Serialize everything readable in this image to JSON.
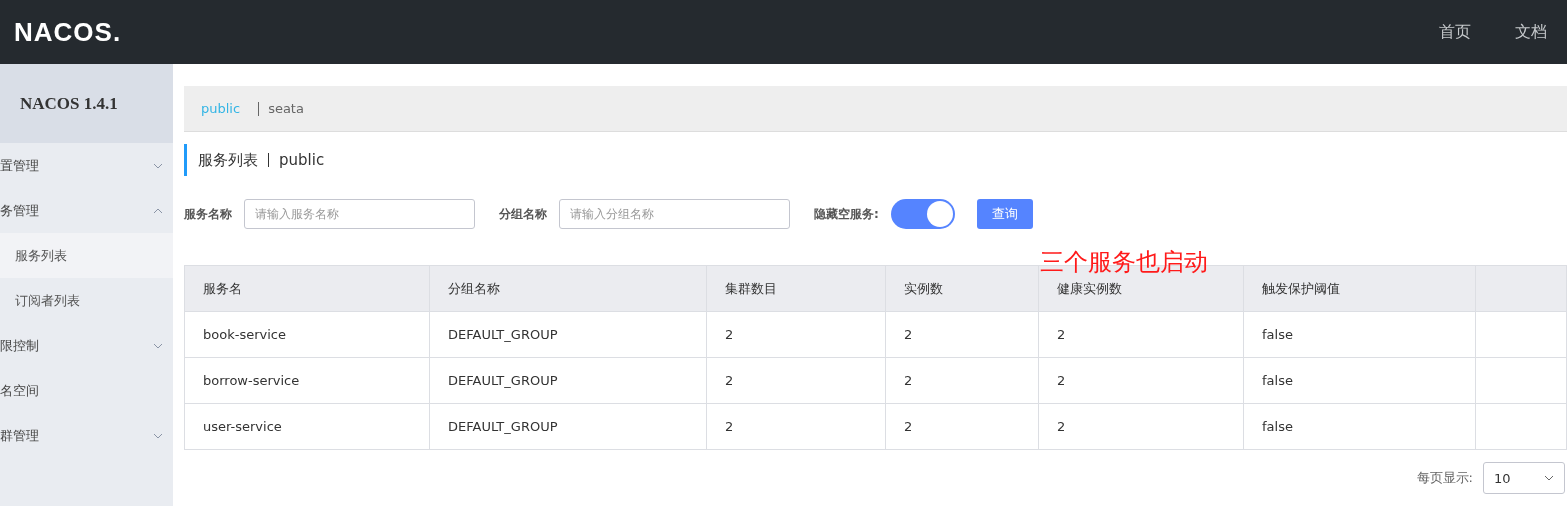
{
  "header": {
    "logo": "NACOS.",
    "nav": [
      "首页",
      "文档"
    ]
  },
  "sidebar": {
    "title": "NACOS 1.4.1",
    "items": [
      {
        "label": "置管理",
        "expanded": false
      },
      {
        "label": "务管理",
        "expanded": true,
        "children": [
          {
            "label": "服务列表",
            "selected": true
          },
          {
            "label": "订阅者列表",
            "selected": false
          }
        ]
      },
      {
        "label": "限控制",
        "expanded": false
      },
      {
        "label": "名空间"
      },
      {
        "label": "群管理",
        "expanded": false
      }
    ]
  },
  "namespaces": [
    {
      "label": "public",
      "selected": true
    },
    {
      "label": "seata",
      "selected": false
    }
  ],
  "page_title": {
    "title": "服务列表",
    "namespace": "public"
  },
  "filters": {
    "service_label": "服务名称",
    "service_placeholder": "请输入服务名称",
    "group_label": "分组名称",
    "group_placeholder": "请输入分组名称",
    "hide_label": "隐藏空服务:",
    "hide_on": true,
    "query_button": "查询"
  },
  "annotation": "三个服务也启动",
  "table": {
    "columns": [
      "服务名",
      "分组名称",
      "集群数目",
      "实例数",
      "健康实例数",
      "触发保护阈值"
    ],
    "rows": [
      [
        "book-service",
        "DEFAULT_GROUP",
        "2",
        "2",
        "2",
        "false"
      ],
      [
        "borrow-service",
        "DEFAULT_GROUP",
        "2",
        "2",
        "2",
        "false"
      ],
      [
        "user-service",
        "DEFAULT_GROUP",
        "2",
        "2",
        "2",
        "false"
      ]
    ]
  },
  "pagination": {
    "label": "每页显示:",
    "page_size": "10"
  }
}
